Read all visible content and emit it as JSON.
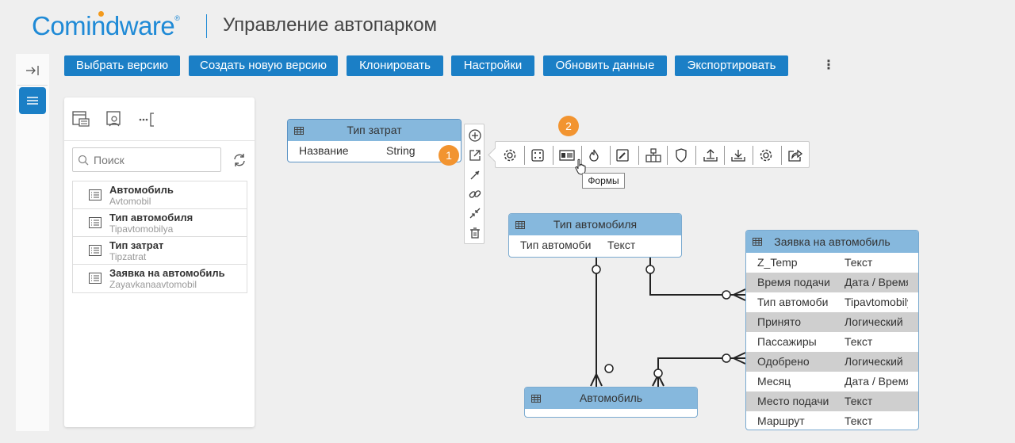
{
  "header": {
    "logo_part1": "Com",
    "logo_part2": "i",
    "logo_part3": "ndware",
    "logo_reg": "®",
    "title": "Управление автопарком"
  },
  "toolbar": {
    "buttons": [
      {
        "label": "Выбрать версию"
      },
      {
        "label": "Создать новую версию"
      },
      {
        "label": "Клонировать"
      },
      {
        "label": "Настройки"
      },
      {
        "label": "Обновить данные"
      },
      {
        "label": "Экспортировать"
      }
    ],
    "more": "⋮"
  },
  "panel": {
    "view_icons": [
      "list-view-icon",
      "user-view-icon",
      "collapse-view-icon"
    ],
    "search_placeholder": "Поиск",
    "items": [
      {
        "name": "Автомобиль",
        "system": "Avtomobil"
      },
      {
        "name": "Тип автомобиля",
        "system": "Tipavtomobilya"
      },
      {
        "name": "Тип затрат",
        "system": "Tipzatrat"
      },
      {
        "name": "Заявка на автомобиль",
        "system": "Zayavkanaavtomobil"
      }
    ]
  },
  "diagram": {
    "tip_zatrat": {
      "title": "Тип затрат",
      "rows": [
        {
          "name": "Название",
          "type": "String"
        }
      ]
    },
    "tip_avtomobilya": {
      "title": "Тип автомобиля",
      "rows": [
        {
          "name": "Тип автомоби",
          "type": "Текст"
        }
      ]
    },
    "zayavka": {
      "title": "Заявка на автомобиль",
      "rows": [
        {
          "name": "Z_Temp",
          "type": "Текст"
        },
        {
          "name": "Время подачи",
          "type": "Дата / Время"
        },
        {
          "name": "Тип автомоби",
          "type": "Tipavtomobilya"
        },
        {
          "name": "Принято",
          "type": "Логический"
        },
        {
          "name": "Пассажиры",
          "type": "Текст"
        },
        {
          "name": "Одобрено",
          "type": "Логический"
        },
        {
          "name": "Месяц",
          "type": "Дата / Время"
        },
        {
          "name": "Место подачи",
          "type": "Текст"
        },
        {
          "name": "Маршрут",
          "type": "Текст"
        }
      ]
    },
    "avtomobil": {
      "title": "Автомобиль"
    }
  },
  "tools": {
    "vertical": [
      "add-icon",
      "open-external-icon",
      "arrow-icon",
      "link-icon",
      "collapse-icon",
      "delete-icon"
    ],
    "horizontal": [
      "settings-icon",
      "dice-icon",
      "forms-icon",
      "fire-icon",
      "edit-icon",
      "structure-icon",
      "shield-icon",
      "upload-icon",
      "download-icon",
      "gear-icon",
      "share-icon"
    ]
  },
  "tooltip": "Формы",
  "badges": [
    "1",
    "2"
  ],
  "colors": {
    "accent": "#1b7fc6",
    "entity_header": "#86b8dd",
    "badge": "#f29430"
  }
}
